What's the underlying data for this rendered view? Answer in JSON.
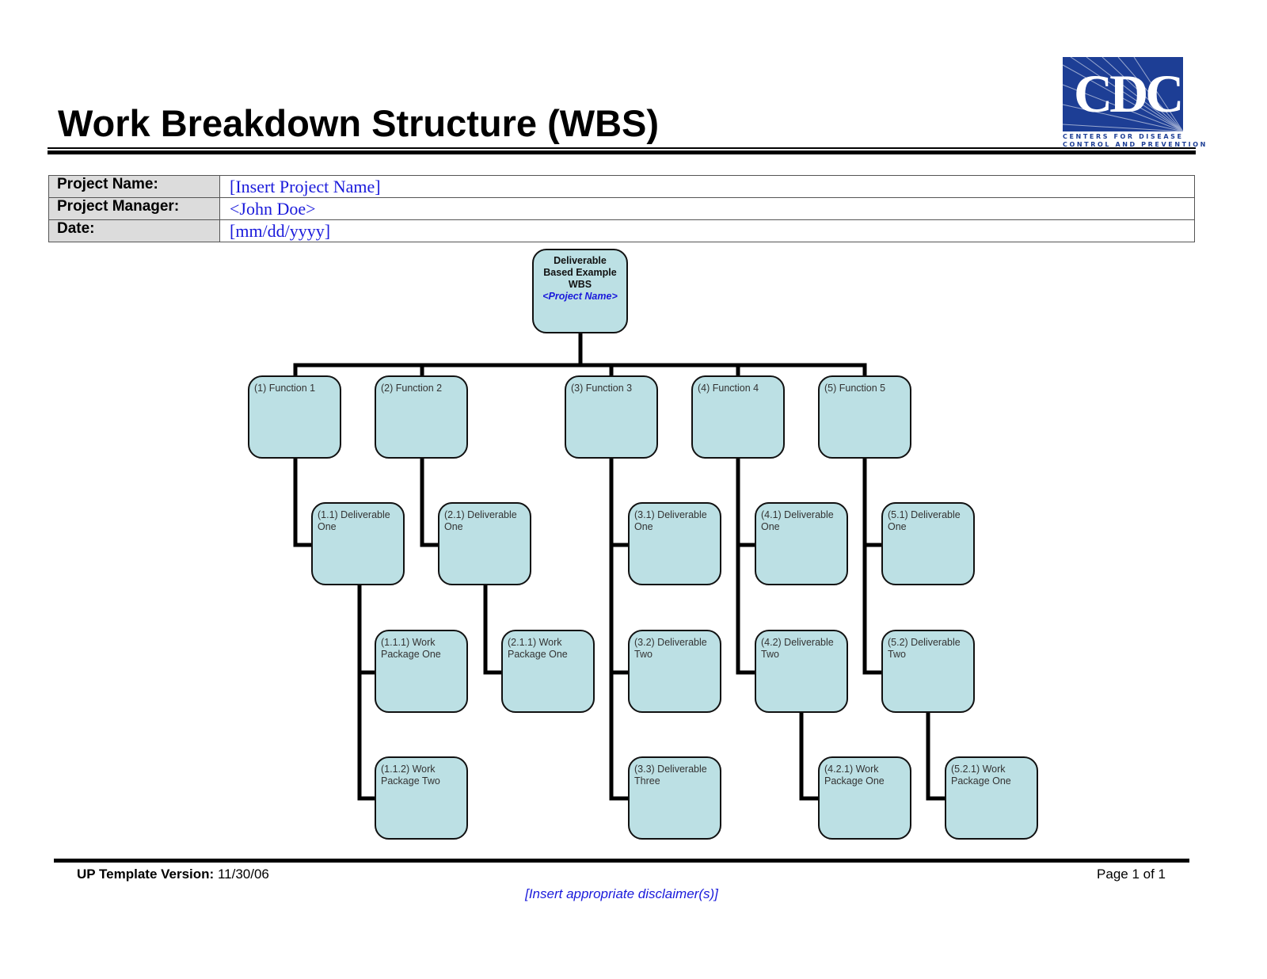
{
  "header": {
    "title": "Work Breakdown Structure (WBS)",
    "logo": {
      "mark": "CDC",
      "line1": "CENTERS FOR DISEASE",
      "line2": "CONTROL AND PREVENTION",
      "brand_color": "#1d3e95"
    }
  },
  "project_info": [
    {
      "label": "Project Name:",
      "value": "[Insert Project Name]"
    },
    {
      "label": "Project Manager:",
      "value": "<John Doe>"
    },
    {
      "label": "Date:",
      "value": "[mm/dd/yyyy]"
    }
  ],
  "wbs": {
    "root": {
      "line1": "Deliverable",
      "line2": "Based Example",
      "line3": "WBS",
      "project_name": "<Project Name>"
    },
    "nodes": [
      {
        "id": "f1",
        "text": "(1) Function 1"
      },
      {
        "id": "f2",
        "text": "(2) Function 2"
      },
      {
        "id": "f3",
        "text": "(3) Function 3"
      },
      {
        "id": "f4",
        "text": "(4) Function 4"
      },
      {
        "id": "f5",
        "text": "(5) Function 5"
      },
      {
        "id": "d11",
        "text": "(1.1) Deliverable One"
      },
      {
        "id": "d21",
        "text": "(2.1) Deliverable One"
      },
      {
        "id": "d31",
        "text": "(3.1) Deliverable One"
      },
      {
        "id": "d41",
        "text": "(4.1) Deliverable One"
      },
      {
        "id": "d51",
        "text": "(5.1) Deliverable One"
      },
      {
        "id": "w111",
        "text": "(1.1.1) Work Package One"
      },
      {
        "id": "w211",
        "text": "(2.1.1) Work Package One"
      },
      {
        "id": "d32",
        "text": "(3.2) Deliverable Two"
      },
      {
        "id": "d42",
        "text": "(4.2) Deliverable Two"
      },
      {
        "id": "d52",
        "text": "(5.2) Deliverable Two"
      },
      {
        "id": "w112",
        "text": "(1.1.2) Work Package Two"
      },
      {
        "id": "d33",
        "text": "(3.3) Deliverable Three"
      },
      {
        "id": "w421",
        "text": "(4.2.1) Work Package One"
      },
      {
        "id": "w521",
        "text": "(5.2.1) Work Package One"
      }
    ]
  },
  "footer": {
    "version_label": "UP Template Version:",
    "version_value": "11/30/06",
    "page": "Page 1 of 1",
    "disclaimer": "[Insert appropriate disclaimer(s)]"
  }
}
